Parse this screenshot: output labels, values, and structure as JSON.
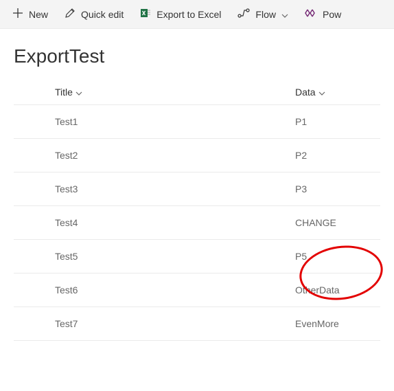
{
  "toolbar": {
    "new_label": "New",
    "quick_edit_label": "Quick edit",
    "export_label": "Export to Excel",
    "flow_label": "Flow",
    "power_label": "Pow"
  },
  "page": {
    "title": "ExportTest"
  },
  "columns": {
    "title": "Title",
    "data": "Data"
  },
  "rows": [
    {
      "title": "Test1",
      "data": "P1"
    },
    {
      "title": "Test2",
      "data": "P2"
    },
    {
      "title": "Test3",
      "data": "P3"
    },
    {
      "title": "Test4",
      "data": "CHANGE"
    },
    {
      "title": "Test5",
      "data": "P5"
    },
    {
      "title": "Test6",
      "data": "OtherData"
    },
    {
      "title": "Test7",
      "data": "EvenMore"
    }
  ]
}
